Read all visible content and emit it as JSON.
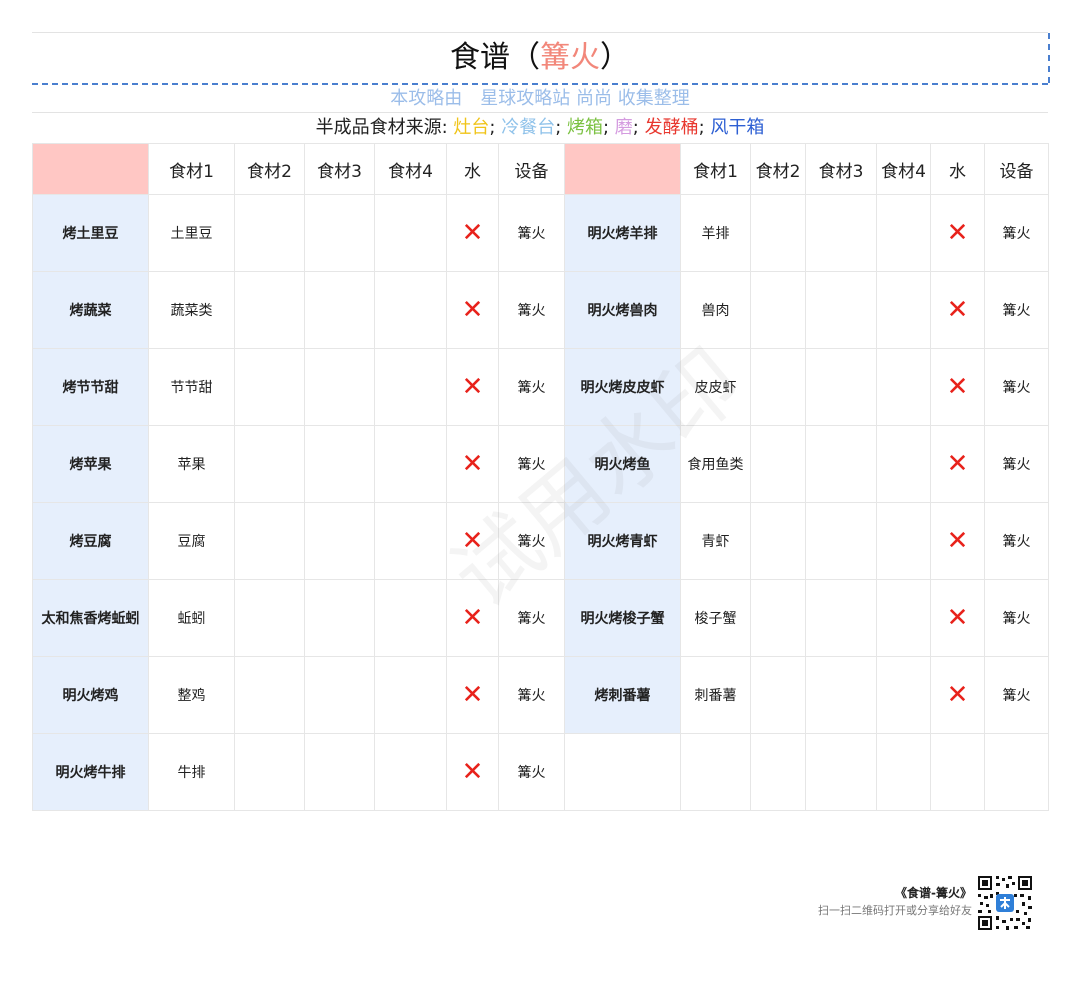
{
  "title": {
    "prefix": "食谱（",
    "accent": "篝火",
    "suffix": "）"
  },
  "credit": {
    "part1": "本攻略由",
    "part2": "星球攻略站 尚尚 收集整理"
  },
  "sources": {
    "label": "半成品食材来源: ",
    "items": [
      {
        "text": "灶台",
        "color": "#f0c419"
      },
      {
        "text": "冷餐台",
        "color": "#8fc2ea"
      },
      {
        "text": "烤箱",
        "color": "#7cc243"
      },
      {
        "text": "磨",
        "color": "#d59ce0"
      },
      {
        "text": "发酵桶",
        "color": "#e8382f"
      },
      {
        "text": "风干箱",
        "color": "#2d5fd3"
      }
    ],
    "sep": "; "
  },
  "headers": [
    "",
    "食材1",
    "食材2",
    "食材3",
    "食材4",
    "水",
    "设备"
  ],
  "water_mark": "✕",
  "rows": [
    {
      "left": {
        "dish": "烤土里豆",
        "ing1": "土里豆",
        "equip": "篝火"
      },
      "right": {
        "dish": "明火烤羊排",
        "ing1": "羊排",
        "equip": "篝火"
      }
    },
    {
      "left": {
        "dish": "烤蔬菜",
        "ing1": "蔬菜类",
        "equip": "篝火"
      },
      "right": {
        "dish": "明火烤兽肉",
        "ing1": "兽肉",
        "equip": "篝火"
      }
    },
    {
      "left": {
        "dish": "烤节节甜",
        "ing1": "节节甜",
        "equip": "篝火"
      },
      "right": {
        "dish": "明火烤皮皮虾",
        "ing1": "皮皮虾",
        "equip": "篝火"
      }
    },
    {
      "left": {
        "dish": "烤苹果",
        "ing1": "苹果",
        "equip": "篝火"
      },
      "right": {
        "dish": "明火烤鱼",
        "ing1": "食用鱼类",
        "equip": "篝火"
      }
    },
    {
      "left": {
        "dish": "烤豆腐",
        "ing1": "豆腐",
        "equip": "篝火"
      },
      "right": {
        "dish": "明火烤青虾",
        "ing1": "青虾",
        "equip": "篝火"
      }
    },
    {
      "left": {
        "dish": "太和焦香烤蚯蚓",
        "ing1": "蚯蚓",
        "equip": "篝火"
      },
      "right": {
        "dish": "明火烤梭子蟹",
        "ing1": "梭子蟹",
        "equip": "篝火"
      }
    },
    {
      "left": {
        "dish": "明火烤鸡",
        "ing1": "整鸡",
        "equip": "篝火"
      },
      "right": {
        "dish": "烤刺番薯",
        "ing1": "刺番薯",
        "equip": "篝火"
      }
    },
    {
      "left": {
        "dish": "明火烤牛排",
        "ing1": "牛排",
        "equip": "篝火"
      },
      "right": null
    }
  ],
  "footer": {
    "title": "《食谱-篝火》",
    "subtitle": "扫一扫二维码打开或分享给好友"
  },
  "watermark": "试用水印"
}
